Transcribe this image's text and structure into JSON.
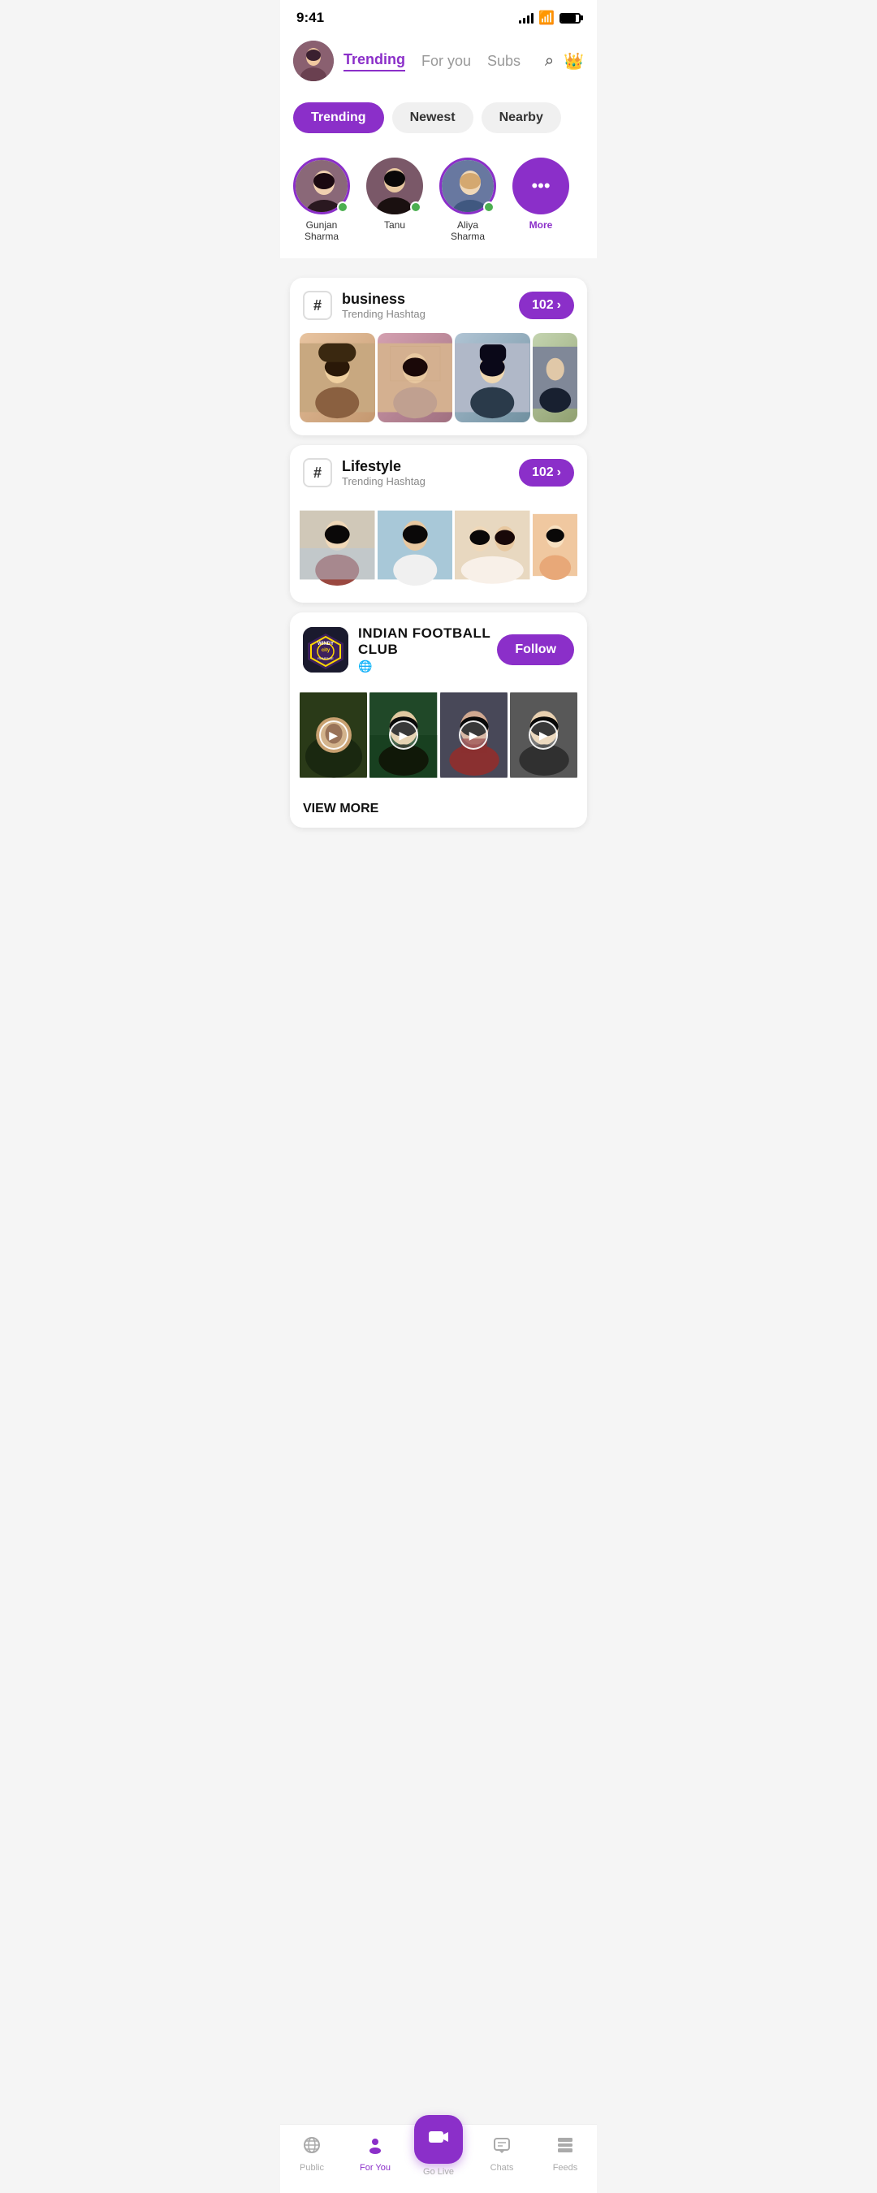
{
  "status": {
    "time": "9:41"
  },
  "header": {
    "nav_tabs": [
      {
        "label": "Trending",
        "active": true
      },
      {
        "label": "For you",
        "active": false
      },
      {
        "label": "Subs",
        "active": false
      }
    ]
  },
  "filters": [
    {
      "label": "Trending",
      "active": true
    },
    {
      "label": "Newest",
      "active": false
    },
    {
      "label": "Nearby",
      "active": false
    }
  ],
  "stories": [
    {
      "name": "Gunjan Sharma",
      "online": true
    },
    {
      "name": "Tanu",
      "online": true
    },
    {
      "name": "Aliya Sharma",
      "online": true
    },
    {
      "name": "More",
      "online": false
    }
  ],
  "hashtags": [
    {
      "tag": "business",
      "sub": "Trending Hashtag",
      "count": "102"
    },
    {
      "tag": "Lifestyle",
      "sub": "Trending Hashtag",
      "count": "102"
    }
  ],
  "club": {
    "name": "INDIAN FOOTBALL CLUB",
    "type": "🌐",
    "logo_line1": "WINDY",
    "logo_line2": "city",
    "follow_label": "Follow",
    "view_more": "VIEW MORE"
  },
  "bottom_nav": [
    {
      "label": "Public",
      "icon": "📡",
      "active": false
    },
    {
      "label": "For You",
      "icon": "👤",
      "active": true
    },
    {
      "label": "Go Live",
      "icon": "🎥",
      "active": false,
      "special": true
    },
    {
      "label": "Chats",
      "icon": "💬",
      "active": false
    },
    {
      "label": "Feeds",
      "icon": "📋",
      "active": false
    }
  ]
}
